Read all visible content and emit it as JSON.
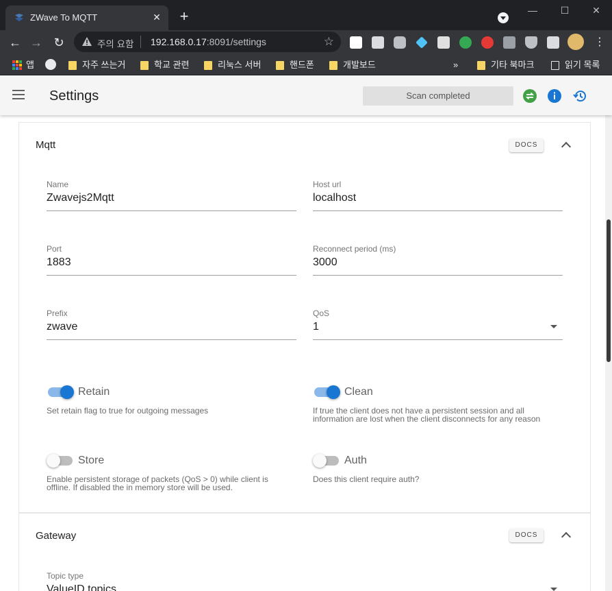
{
  "browser": {
    "tab_title": "ZWave To MQTT",
    "tab_close": "✕",
    "new_tab": "+",
    "window": {
      "minimize": "—",
      "maximize": "☐",
      "close": "✕"
    },
    "omnibox": {
      "security_label": "주의 요함",
      "host": "192.168.0.17",
      "path": ":8091/settings"
    },
    "bookmarks": {
      "apps_label": "앱",
      "items": [
        "자주 쓰는거",
        "학교 관련",
        "리눅스 서버",
        "핸드폰",
        "개발보드"
      ],
      "overflow": "»",
      "other": "기타 북마크",
      "reading_list": "읽기 목록"
    }
  },
  "app": {
    "title": "Settings",
    "status": "Scan completed",
    "colors": {
      "primary": "#1976d2",
      "success": "#43a047"
    }
  },
  "mqtt": {
    "title": "Mqtt",
    "docs_label": "DOCS",
    "name": {
      "label": "Name",
      "value": "Zwavejs2Mqtt"
    },
    "host": {
      "label": "Host url",
      "value": "localhost"
    },
    "port": {
      "label": "Port",
      "value": "1883"
    },
    "reconnect": {
      "label": "Reconnect period (ms)",
      "value": "3000"
    },
    "prefix": {
      "label": "Prefix",
      "value": "zwave"
    },
    "qos": {
      "label": "QoS",
      "value": "1"
    },
    "retain": {
      "label": "Retain",
      "on": true,
      "hint": "Set retain flag to true for outgoing messages"
    },
    "clean": {
      "label": "Clean",
      "on": true,
      "hint_1": "If true the client does not have a persistent session and all",
      "hint_2": "information are lost when the client disconnects for any reason"
    },
    "store": {
      "label": "Store",
      "on": false,
      "hint_1": "Enable persistent storage of packets (QoS > 0) while client is",
      "hint_2": "offline. If disabled the in memory store will be used."
    },
    "auth": {
      "label": "Auth",
      "on": false,
      "hint": "Does this client require auth?"
    }
  },
  "gateway": {
    "title": "Gateway",
    "docs_label": "DOCS",
    "topic_type": {
      "label": "Topic type",
      "value": "ValueID topics"
    }
  }
}
